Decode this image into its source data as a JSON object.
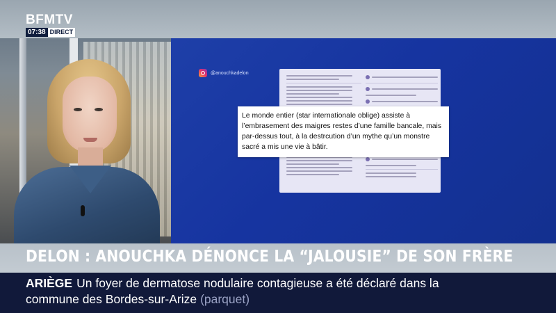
{
  "header": {
    "channel": "BFMTV",
    "time": "07:38",
    "live_label": "DIRECT"
  },
  "panel": {
    "instagram_handle": "@anouchkadelon",
    "quote": "Le monde entier (star internationale oblige) assiste à l’embrasement des maigres restes d’une famille bancale, mais par-dessus tout, à la destrcution d’un mythe qu’un monstre sacré a mis une vie à bâtir."
  },
  "headline": {
    "text": "DELON : ANOUCHKA DÉNONCE LA “JALOUSIE” DE SON FRÈRE"
  },
  "ticker": {
    "region": "ARIÈGE",
    "line1": "Un foyer de dermatose nodulaire contagieuse a été déclaré dans la",
    "line2": "commune des Bordes-sur-Arize",
    "source": "(parquet)"
  },
  "icons": {
    "instagram": "instagram-icon"
  },
  "colors": {
    "panel_blue": "#1634a0",
    "ticker_bg": "#11193a",
    "headline_bg": "#c3cbd2"
  }
}
